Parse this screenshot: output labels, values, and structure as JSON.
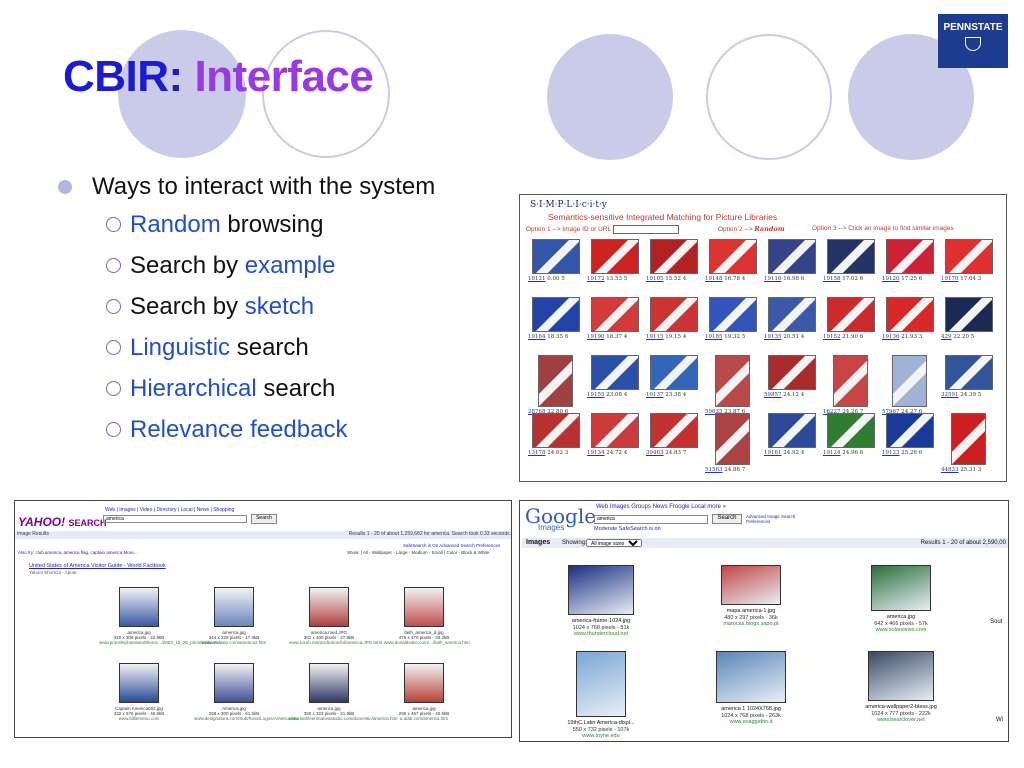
{
  "slide": {
    "title_prefix": "CBIR:",
    "title_accent": "Interface",
    "logo_text": "PENNSTATE",
    "bullet": "Ways to interact with the system",
    "subs": [
      {
        "hi": "Random",
        "rest": " browsing",
        "hi_first": true
      },
      {
        "hi": "example",
        "rest": "Search by ",
        "hi_first": false
      },
      {
        "hi": "sketch",
        "rest": "Search by ",
        "hi_first": false
      },
      {
        "hi": "Linguistic",
        "rest": " search",
        "hi_first": true
      },
      {
        "hi": "Hierarchical",
        "rest": " search",
        "hi_first": true
      },
      {
        "hi": "Relevance feedback",
        "rest": "",
        "hi_first": true
      }
    ]
  },
  "simplicity": {
    "logo": "S·I·M·P·L·I·c·i·t·y",
    "subtitle": "Semantics-sensitive Integrated Matching for Picture Libraries",
    "option1": "Option 1 -->   Image ID or URL",
    "option2": "Option 2 -->",
    "random": "Random",
    "option3": "Option 3 -->   Click an image to find similar images",
    "items": [
      {
        "id": "19121",
        "score": "0.00",
        "n": "5",
        "color": "#3355aa"
      },
      {
        "id": "19172",
        "score": "13.53",
        "n": "5",
        "color": "#cc2222"
      },
      {
        "id": "19105",
        "score": "15.52",
        "n": "4",
        "color": "#b22222"
      },
      {
        "id": "19148",
        "score": "16.78",
        "n": "4",
        "color": "#dd3333"
      },
      {
        "id": "19116",
        "score": "16.98",
        "n": "6",
        "color": "#334488"
      },
      {
        "id": "19158",
        "score": "17.02",
        "n": "6",
        "color": "#223366"
      },
      {
        "id": "19120",
        "score": "17.25",
        "n": "6",
        "color": "#cc2233"
      },
      {
        "id": "19170",
        "score": "17.64",
        "n": "3",
        "color": "#e03030"
      },
      {
        "id": "19184",
        "score": "18.35",
        "n": "6",
        "color": "#2244aa"
      },
      {
        "id": "19190",
        "score": "18.37",
        "n": "4",
        "color": "#d43a3a"
      },
      {
        "id": "19115",
        "score": "19.15",
        "n": "4",
        "color": "#cc3333"
      },
      {
        "id": "19185",
        "score": "19.32",
        "n": "5",
        "color": "#3355bb"
      },
      {
        "id": "19135",
        "score": "20.51",
        "n": "4",
        "color": "#3a5aa8"
      },
      {
        "id": "19152",
        "score": "21.90",
        "n": "6",
        "color": "#cc2a2a"
      },
      {
        "id": "19136",
        "score": "21.93",
        "n": "3",
        "color": "#d92828"
      },
      {
        "id": "429",
        "score": "22.20",
        "n": "5",
        "color": "#1a2a55"
      },
      {
        "id": "28768",
        "score": "22.80",
        "n": "6",
        "color": "#a04040"
      },
      {
        "id": "19155",
        "score": "23.08",
        "n": "4",
        "color": "#2b50aa"
      },
      {
        "id": "19137",
        "score": "23.38",
        "n": "4",
        "color": "#3366bb"
      },
      {
        "id": "59635",
        "score": "23.87",
        "n": "6",
        "color": "#b84a4a"
      },
      {
        "id": "59857",
        "score": "24.12",
        "n": "4",
        "color": "#aa2b2b"
      },
      {
        "id": "16227",
        "score": "24.26",
        "n": "7",
        "color": "#c74545"
      },
      {
        "id": "57967",
        "score": "24.27",
        "n": "6",
        "color": "#9fb3d6"
      },
      {
        "id": "32591",
        "score": "24.39",
        "n": "5",
        "color": "#335599"
      },
      {
        "id": "13178",
        "score": "24.62",
        "n": "3",
        "color": "#b83030"
      },
      {
        "id": "19134",
        "score": "24.72",
        "n": "4",
        "color": "#cc3b3b"
      },
      {
        "id": "39463",
        "score": "24.83",
        "n": "7",
        "color": "#c33030"
      },
      {
        "id": "51563",
        "score": "24.86",
        "n": "7",
        "color": "#aa4444"
      },
      {
        "id": "19161",
        "score": "24.92",
        "n": "4",
        "color": "#2b4a99"
      },
      {
        "id": "19124",
        "score": "24.96",
        "n": "6",
        "color": "#2e7d32"
      },
      {
        "id": "19123",
        "score": "25.26",
        "n": "6",
        "color": "#1a3a99"
      },
      {
        "id": "44833",
        "score": "25.31",
        "n": "3",
        "color": "#cc2020"
      }
    ]
  },
  "yahoo": {
    "logo": "YAHOO!",
    "search_word": "SEARCH",
    "tabs": "Web | Images | Video | Directory | Local | News | Shopping",
    "query": "america",
    "button": "Search",
    "bar_left": "Image Results",
    "bar_right": "Results 1 - 20 of about 1,259,682 for america. Search took 0.33 seconds.",
    "safe": "SafeSearch is On    Advanced Search    Preferences",
    "show": "Show: | All - Wallpaper - Large - Medium - Small | Color - Black & White",
    "also": "Also try: club america, america flag, captain america  More...",
    "result1": "United States of America Visitor Guide - World Factbook",
    "result1_sub": "Yahoo! Shortcut - About",
    "items": [
      {
        "name": "america.jpg",
        "meta": "320 x 309 pixels - 22.9kB",
        "url": "www.primelephantsandthems.../2003_10_28_primelephants...",
        "color": "#3b5aa6"
      },
      {
        "name": "america.jpg",
        "meta": "344 x 229 pixels - 17.9kB",
        "url": "www.midwep.com/america2.htm",
        "color": "#6a85c0"
      },
      {
        "name": "america.med.JPG",
        "meta": "301 x 400 pixels - 27.8kB",
        "url": "www.tuxoh.net/pochurion/lol/america.JPG.html",
        "color": "#b04040"
      },
      {
        "name": "faith_america_d.jpg",
        "meta": "476 x 470 pixels - 33.2kB",
        "url": "www.donaldsden.com/.../faith_america.htm",
        "color": "#c05050"
      },
      {
        "name": "Captain America002.jpg",
        "meta": "432 x 576 pixels - 46.8kB",
        "url": "www.billiemenu.com",
        "color": "#2a4a99"
      },
      {
        "name": "America.jpg",
        "meta": "258 x 300 pixels - 61.5kB",
        "url": "www.designatora.com/Sub/Rose/Logos/America.htm",
        "color": "#405098"
      },
      {
        "name": "america.jpg",
        "meta": "350 x 323 pixels - 21.9kB",
        "url": "www.kathleenmarieastudio.com/domestic/america.htm",
        "color": "#2e3a66"
      },
      {
        "name": "america.jpg",
        "meta": "296 x 467 pixels - 40.5kB",
        "url": "a.addr.com/america.htm",
        "color": "#b8433a"
      }
    ]
  },
  "google": {
    "logo_g": "Google",
    "logo_sub": "Images",
    "tabs": "Web   Images   Groups   News   Froogle   Local   more »",
    "query": "america",
    "button": "Search",
    "adv": "Advanced Image Search",
    "prefs": "Preferences",
    "safe": "Moderate SafeSearch is on",
    "bar_title": "Images",
    "bar_show": "Showing:",
    "bar_select": "All image sizes",
    "bar_res": "Results 1 - 20 of about 2,590,00",
    "items": [
      {
        "name": "america-frame-1024.jpg",
        "meta": "1024 x 768 pixels - 81k",
        "url": "www.thundercloud.net",
        "color": "#1a2f80"
      },
      {
        "name": "mapa america-1.jpg",
        "meta": "480 x 297 pixels - 36k",
        "url": "marocas.blogs.sapo.pt",
        "color": "#c24545"
      },
      {
        "name": "america.jpg",
        "meta": "642 x 466 pixels - 57k",
        "url": "www.solarviews.com",
        "color": "#2a6f3a"
      },
      {
        "name": "19thC.Latin America-displ...",
        "meta": "550 x 732 pixels - 107k",
        "url": "www.toyne.edu",
        "color": "#7aa6d6"
      },
      {
        "name": "america 1 1024X768.jpg",
        "meta": "1024 x 768 pixels - 263k",
        "url": "www.evaggidon.it",
        "color": "#5a86b8"
      },
      {
        "name": "america-wallpaper2-bless.jpg",
        "meta": "1024 x 777 pixels - 222k",
        "url": "www.bearclover.net",
        "color": "#394a66"
      }
    ],
    "edge_right": [
      "Sout",
      "Wi"
    ]
  }
}
